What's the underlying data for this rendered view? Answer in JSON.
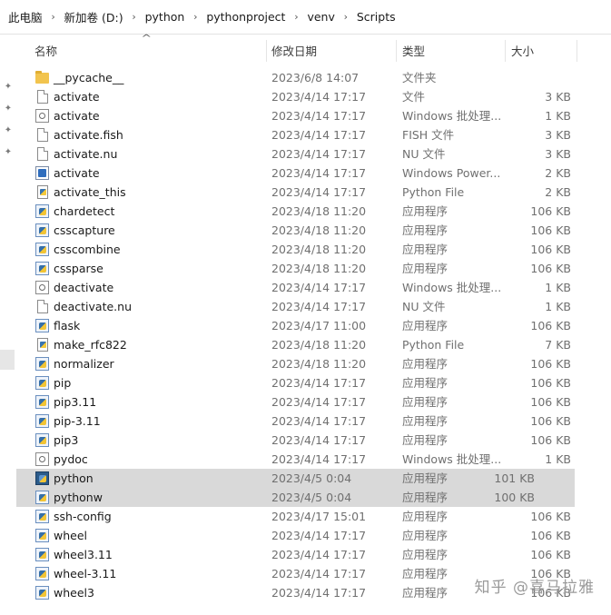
{
  "breadcrumb": [
    "此电脑",
    "新加卷 (D:)",
    "python",
    "pythonproject",
    "venv",
    "Scripts"
  ],
  "columns": {
    "name": "名称",
    "date": "修改日期",
    "type": "类型",
    "size": "大小"
  },
  "files": [
    {
      "name": "__pycache__",
      "date": "2023/6/8 14:07",
      "type": "文件夹",
      "size": "",
      "icon": "folder-icon"
    },
    {
      "name": "activate",
      "date": "2023/4/14 17:17",
      "type": "文件",
      "size": "3 KB",
      "icon": "file-icon"
    },
    {
      "name": "activate",
      "date": "2023/4/14 17:17",
      "type": "Windows 批处理...",
      "size": "1 KB",
      "icon": "batch-file-icon"
    },
    {
      "name": "activate.fish",
      "date": "2023/4/14 17:17",
      "type": "FISH 文件",
      "size": "3 KB",
      "icon": "file-icon"
    },
    {
      "name": "activate.nu",
      "date": "2023/4/14 17:17",
      "type": "NU 文件",
      "size": "3 KB",
      "icon": "file-icon"
    },
    {
      "name": "activate",
      "date": "2023/4/14 17:17",
      "type": "Windows Power...",
      "size": "2 KB",
      "icon": "powershell-script-icon"
    },
    {
      "name": "activate_this",
      "date": "2023/4/14 17:17",
      "type": "Python File",
      "size": "2 KB",
      "icon": "python-file-icon"
    },
    {
      "name": "chardetect",
      "date": "2023/4/18 11:20",
      "type": "应用程序",
      "size": "106 KB",
      "icon": "application-icon"
    },
    {
      "name": "csscapture",
      "date": "2023/4/18 11:20",
      "type": "应用程序",
      "size": "106 KB",
      "icon": "application-icon"
    },
    {
      "name": "csscombine",
      "date": "2023/4/18 11:20",
      "type": "应用程序",
      "size": "106 KB",
      "icon": "application-icon"
    },
    {
      "name": "cssparse",
      "date": "2023/4/18 11:20",
      "type": "应用程序",
      "size": "106 KB",
      "icon": "application-icon"
    },
    {
      "name": "deactivate",
      "date": "2023/4/14 17:17",
      "type": "Windows 批处理...",
      "size": "1 KB",
      "icon": "batch-file-icon"
    },
    {
      "name": "deactivate.nu",
      "date": "2023/4/14 17:17",
      "type": "NU 文件",
      "size": "1 KB",
      "icon": "file-icon"
    },
    {
      "name": "flask",
      "date": "2023/4/17 11:00",
      "type": "应用程序",
      "size": "106 KB",
      "icon": "application-icon"
    },
    {
      "name": "make_rfc822",
      "date": "2023/4/18 11:20",
      "type": "Python File",
      "size": "7 KB",
      "icon": "python-file-icon"
    },
    {
      "name": "normalizer",
      "date": "2023/4/18 11:20",
      "type": "应用程序",
      "size": "106 KB",
      "icon": "application-icon"
    },
    {
      "name": "pip",
      "date": "2023/4/14 17:17",
      "type": "应用程序",
      "size": "106 KB",
      "icon": "application-icon"
    },
    {
      "name": "pip3.11",
      "date": "2023/4/14 17:17",
      "type": "应用程序",
      "size": "106 KB",
      "icon": "application-icon"
    },
    {
      "name": "pip-3.11",
      "date": "2023/4/14 17:17",
      "type": "应用程序",
      "size": "106 KB",
      "icon": "application-icon"
    },
    {
      "name": "pip3",
      "date": "2023/4/14 17:17",
      "type": "应用程序",
      "size": "106 KB",
      "icon": "application-icon"
    },
    {
      "name": "pydoc",
      "date": "2023/4/14 17:17",
      "type": "Windows 批处理...",
      "size": "1 KB",
      "icon": "batch-file-icon"
    },
    {
      "name": "python",
      "date": "2023/4/5 0:04",
      "type": "应用程序",
      "size": "101 KB",
      "icon": "python-exe-icon",
      "selected": true
    },
    {
      "name": "pythonw",
      "date": "2023/4/5 0:04",
      "type": "应用程序",
      "size": "100 KB",
      "icon": "pythonw-exe-icon",
      "selected": true
    },
    {
      "name": "ssh-config",
      "date": "2023/4/17 15:01",
      "type": "应用程序",
      "size": "106 KB",
      "icon": "application-icon"
    },
    {
      "name": "wheel",
      "date": "2023/4/14 17:17",
      "type": "应用程序",
      "size": "106 KB",
      "icon": "application-icon"
    },
    {
      "name": "wheel3.11",
      "date": "2023/4/14 17:17",
      "type": "应用程序",
      "size": "106 KB",
      "icon": "application-icon"
    },
    {
      "name": "wheel-3.11",
      "date": "2023/4/14 17:17",
      "type": "应用程序",
      "size": "106 KB",
      "icon": "application-icon"
    },
    {
      "name": "wheel3",
      "date": "2023/4/14 17:17",
      "type": "应用程序",
      "size": "106 KB",
      "icon": "application-icon"
    }
  ],
  "watermark": "知乎 @喜马拉雅",
  "colors": {
    "selection": "#d9d9d9",
    "folder": "#f2c44e",
    "secondary_text": "#707070"
  }
}
